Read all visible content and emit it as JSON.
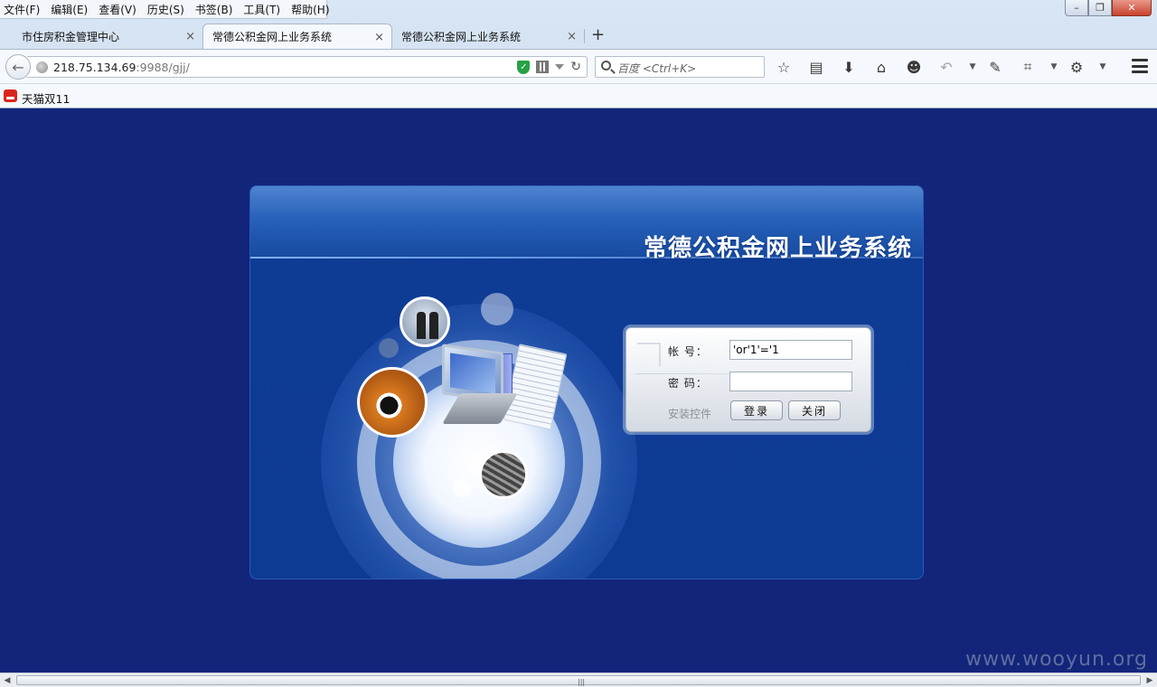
{
  "menubar": {
    "items": [
      "文件(F)",
      "编辑(E)",
      "查看(V)",
      "历史(S)",
      "书签(B)",
      "工具(T)",
      "帮助(H)"
    ]
  },
  "window_controls": {
    "minimize": "–",
    "maximize": "❐",
    "close": "✕"
  },
  "tabs": [
    {
      "label": "市住房积金管理中心",
      "active": false
    },
    {
      "label": "常德公积金网上业务系统",
      "active": true
    },
    {
      "label": "常德公积金网上业务系统",
      "active": false
    }
  ],
  "tab_close_glyph": "×",
  "newtab_glyph": "+",
  "navbar": {
    "url_host": "218.75.134.69",
    "url_rest": ":9988/gjj/",
    "search_placeholder": "百度 <Ctrl+K>"
  },
  "icons": {
    "back": "back-arrow-icon",
    "globe": "globe-icon",
    "shield": "shield-icon",
    "qr": "qr-code-icon",
    "reload": "reload-icon",
    "search": "search-icon",
    "bookmark_star": "star-icon",
    "reader": "clipboard-icon",
    "download": "download-icon",
    "home": "home-icon",
    "chat": "chat-icon",
    "undo": "undo-icon",
    "bubble": "speech-bubble-icon",
    "crop": "crop-icon",
    "translate": "translate-icon",
    "menu": "hamburger-menu-icon"
  },
  "bookmarks": [
    {
      "label": "天猫双11"
    }
  ],
  "page": {
    "system_title": "常德公积金网上业务系统",
    "login": {
      "account_label": "帐  号：",
      "account_value": "'or'1'='1",
      "password_label": "密  码：",
      "password_value": "",
      "install_label": "安装控件",
      "login_button": "登录",
      "close_button": "关闭"
    },
    "watermark": "www.wooyun.org"
  },
  "colors": {
    "page_bg": "#12257a",
    "panel_bg": "#0d3a92",
    "accent_green": "#25a244"
  }
}
